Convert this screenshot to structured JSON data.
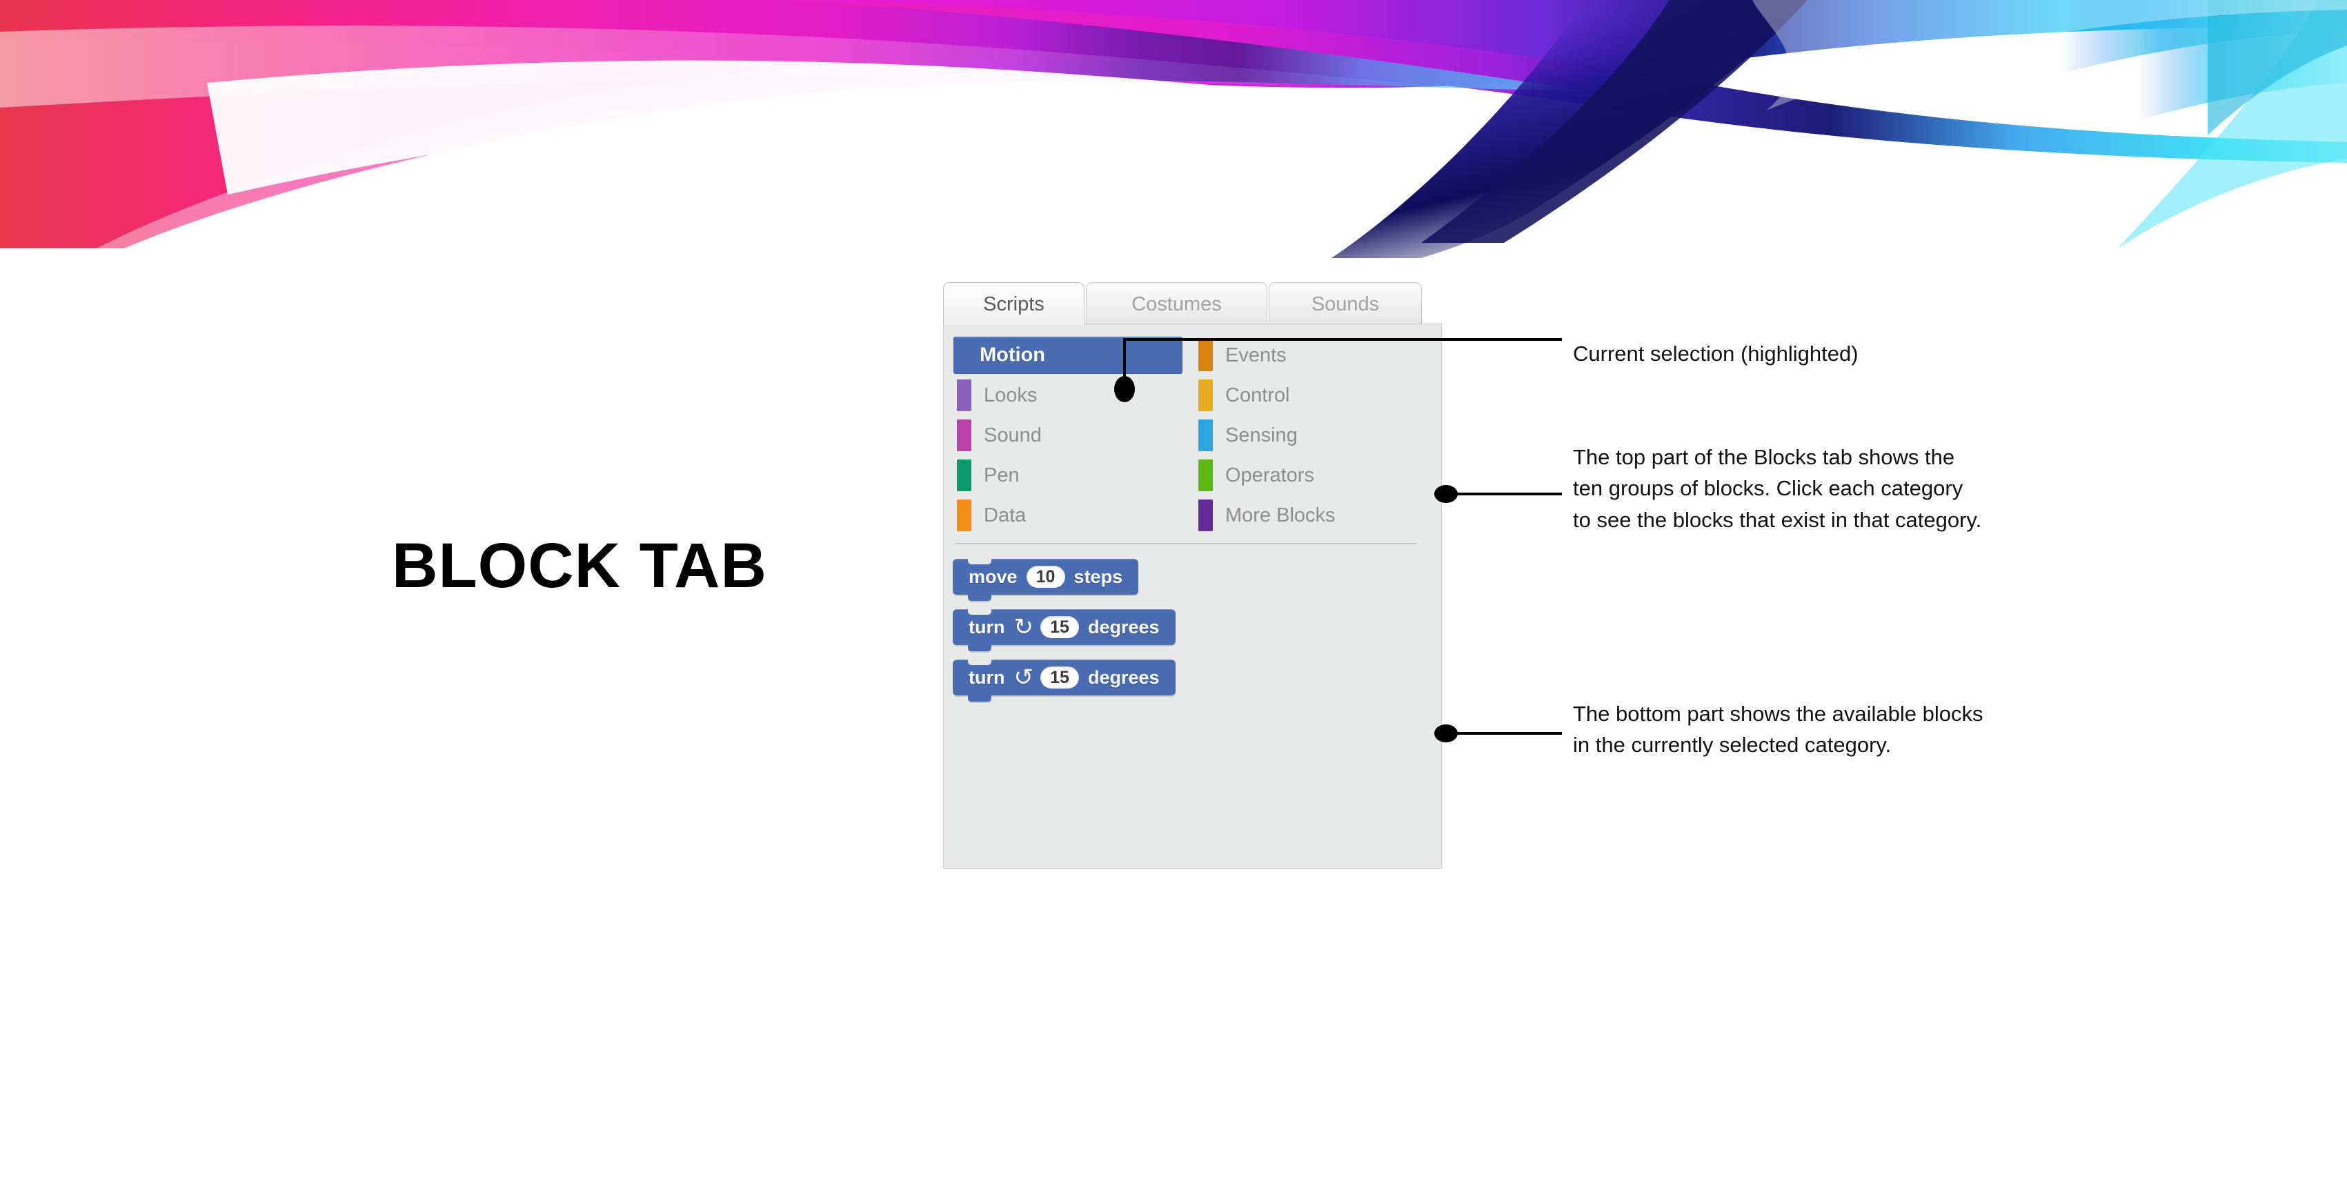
{
  "slide": {
    "title": "BLOCK TAB",
    "background_color": "#ffffff"
  },
  "banner": {
    "name": "decorative-wave-banner",
    "colors": {
      "magenta": "#E81CC8",
      "pink": "#F5237E",
      "red": "#E8344B",
      "navy": "#16166E",
      "purple": "#5B2BD4",
      "blue": "#2B6FE0",
      "cyan": "#22D8F0",
      "light_cyan": "#A8F0FA"
    }
  },
  "panel": {
    "name": "scratch-blocks-panel",
    "background_color": "#e8eae9",
    "tabs": [
      {
        "label": "Scripts",
        "active": true
      },
      {
        "label": "Costumes",
        "active": false
      },
      {
        "label": "Sounds",
        "active": false
      }
    ],
    "categories_left": [
      {
        "label": "Motion",
        "color": "#4a6cb3",
        "selected": true
      },
      {
        "label": "Looks",
        "color": "#8B5FBD",
        "selected": false
      },
      {
        "label": "Sound",
        "color": "#BB42A8",
        "selected": false
      },
      {
        "label": "Pen",
        "color": "#0E9A6C",
        "selected": false
      },
      {
        "label": "Data",
        "color": "#F58B17",
        "selected": false
      }
    ],
    "categories_right": [
      {
        "label": "Events",
        "color": "#D9840E",
        "selected": false
      },
      {
        "label": "Control",
        "color": "#E6AC1B",
        "selected": false
      },
      {
        "label": "Sensing",
        "color": "#2CA5E0",
        "selected": false
      },
      {
        "label": "Operators",
        "color": "#5CB712",
        "selected": false
      },
      {
        "label": "More Blocks",
        "color": "#632D99",
        "selected": false
      }
    ],
    "blocks": [
      {
        "name": "move-steps-block",
        "pre_label": "move",
        "arrow": "",
        "input_value": "10",
        "post_label": "steps",
        "color": "#4a6cb3"
      },
      {
        "name": "turn-clockwise-block",
        "pre_label": "turn",
        "arrow": "↻",
        "input_value": "15",
        "post_label": "degrees",
        "color": "#4a6cb3"
      },
      {
        "name": "turn-counterclockwise-block",
        "pre_label": "turn",
        "arrow": "↺",
        "input_value": "15",
        "post_label": "degrees",
        "color": "#4a6cb3"
      }
    ]
  },
  "callouts": [
    {
      "name": "callout-current-selection",
      "text": "Current selection (highlighted)"
    },
    {
      "name": "callout-top-part",
      "text": "The top part of the Blocks tab shows the\nten groups of blocks. Click each category\nto see the blocks that exist in that category."
    },
    {
      "name": "callout-bottom-part",
      "text": "The bottom part shows the available blocks\nin the currently selected category."
    }
  ]
}
